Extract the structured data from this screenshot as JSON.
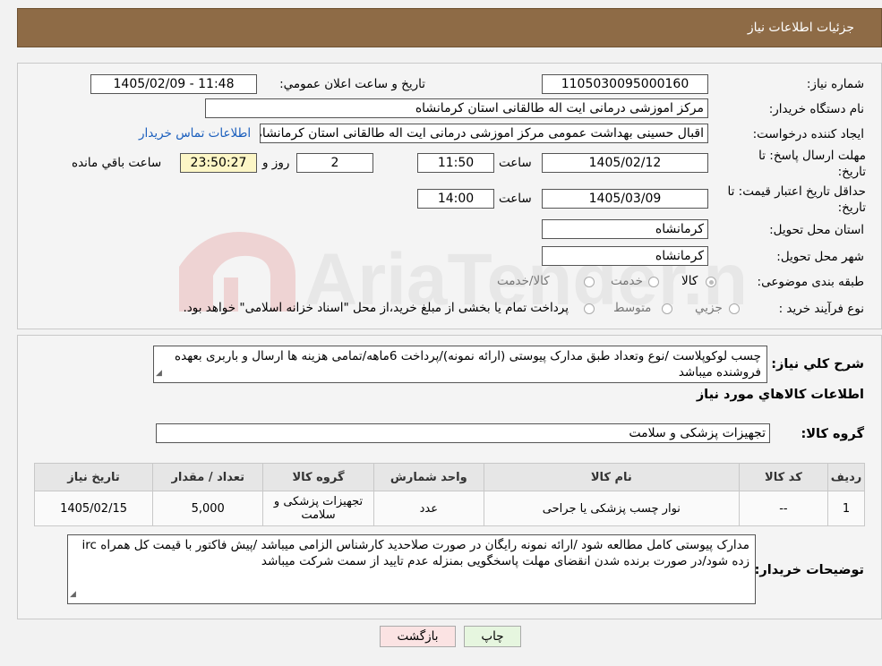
{
  "header": {
    "title": "جزئیات اطلاعات نیاز"
  },
  "form": {
    "need_number_label": "شماره نیاز:",
    "need_number": "1105030095000160",
    "announce_label": "تاریخ و ساعت اعلان عمومي:",
    "announce_value": "1405/02/09 - 11:48",
    "buyer_label": "نام دستگاه خريدار:",
    "buyer_value": "مرکز اموزشی درمانی ایت اله طالقانی استان کرمانشاه",
    "creator_label": "ایجاد کننده درخواست:",
    "creator_value": "اقبال حسینی بهداشت عمومی مرکز اموزشی درمانی ایت اله طالقانی استان کرمانشاه",
    "contact_link": "اطلاعات تماس خریدار",
    "deadline_label_1": "مهلت ارسال پاسخ: تا",
    "deadline_label_2": "تاریخ:",
    "deadline_date": "1405/02/12",
    "time_label": "ساعت",
    "deadline_time": "11:50",
    "days_value": "2",
    "days_label": "روز و",
    "remaining_time": "23:50:27",
    "remaining_label": "ساعت باقي مانده",
    "validity_label_1": "حداقل تاریخ اعتبار قیمت: تا",
    "validity_label_2": "تاریخ:",
    "validity_date": "1405/03/09",
    "validity_time": "14:00",
    "province_label": "استان محل تحویل:",
    "province_value": "کرمانشاه",
    "city_label": "شهر محل تحویل:",
    "city_value": "کرمانشاه",
    "category_label": "طبقه بندی موضوعی:",
    "category_options": [
      "کالا",
      "خدمت",
      "کالا/خدمت"
    ],
    "category_selected": "کالا",
    "process_label": "نوع فرآیند خرید :",
    "process_options": [
      "جزيي",
      "متوسط"
    ],
    "process_note": "پرداخت تمام یا بخشی از مبلغ خرید،از محل \"اسناد خزانه اسلامی\" خواهد بود."
  },
  "description": {
    "label": "شرح کلي نياز:",
    "text": "چسب لوکوپلاست /نوع وتعداد طبق مدارک پیوستی (ارائه نمونه)/پرداخت 6ماهه/تمامی هزینه ها ارسال و باربری بعهده فروشنده میباشد"
  },
  "goods_info": {
    "title": "اطلاعات کالاهاي مورد نياز",
    "group_label": "گروه کالا:",
    "group_value": "تجهیزات پزشکی و سلامت"
  },
  "table": {
    "headers": [
      "رديف",
      "کد کالا",
      "نام کالا",
      "واحد شمارش",
      "گروه کالا",
      "تعداد / مقدار",
      "تاریخ نیاز"
    ],
    "rows": [
      [
        "1",
        "--",
        "نوار چسب پزشکی یا جراحی",
        "عدد",
        "تجهیزات پزشکی و سلامت",
        "5,000",
        "1405/02/15"
      ]
    ]
  },
  "buyer_notes": {
    "label": "توضیحات خریدار:",
    "text": "مدارک پیوستی کامل مطالعه شود /ارائه نمونه رایگان در صورت صلاحدید کارشناس الزامی میباشد /پیش فاکتور با قیمت کل همراه irc  زده شود/در صورت برنده شدن انقضای مهلت پاسخگویی بمنزله عدم تایید از سمت شرکت میباشد"
  },
  "buttons": {
    "print": "چاپ",
    "back": "بازگشت"
  },
  "colors": {
    "header": "#8e6b46",
    "link": "#1a5ebd",
    "remaining_bg": "#fcf6c6",
    "back_btn_bg": "#fbe3e3",
    "print_btn_bg": "#e6f6df"
  },
  "watermark": {
    "text": "AriaTender.neT"
  }
}
